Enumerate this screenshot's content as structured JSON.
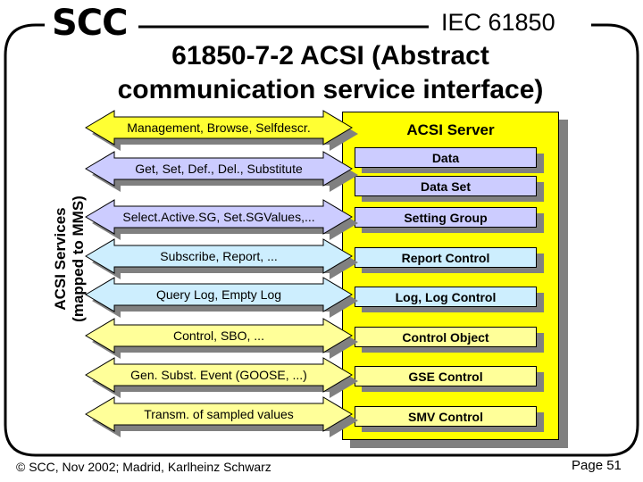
{
  "header": {
    "brand": "SCC",
    "standard": "IEC 61850",
    "title_line1": "61850-7-2 ACSI (Abstract",
    "title_line2": "communication service interface)"
  },
  "side_label": {
    "line1": "ACSI Services",
    "line2": "(mapped to MMS)"
  },
  "colors": {
    "server_fill": "#ffff00",
    "yellow_bright": "#ffff33",
    "lavender": "#ccccff",
    "light_blue": "#cdeefe",
    "light_yellow": "#ffff99",
    "shadow": "#808080"
  },
  "services": [
    {
      "label": "Management, Browse, Selfdescr.",
      "color": "yellow_bright"
    },
    {
      "label": "Get, Set, Def., Del., Substitute",
      "color": "lavender"
    },
    {
      "label": "Select.Active.SG, Set.SGValues,...",
      "color": "lavender"
    },
    {
      "label": "Subscribe, Report, ...",
      "color": "light_blue"
    },
    {
      "label": "Query Log, Empty Log",
      "color": "light_blue"
    },
    {
      "label": "Control, SBO, ...",
      "color": "light_yellow"
    },
    {
      "label": "Gen. Subst. Event (GOOSE, ...)",
      "color": "light_yellow"
    },
    {
      "label": "Transm. of sampled values",
      "color": "light_yellow"
    }
  ],
  "server": {
    "title": "ACSI Server",
    "classes": [
      {
        "label": "Data",
        "color": "lavender"
      },
      {
        "label": "Data Set",
        "color": "lavender"
      },
      {
        "label": "Setting Group",
        "color": "lavender"
      },
      {
        "label": "Report Control",
        "color": "light_blue"
      },
      {
        "label": "Log, Log Control",
        "color": "light_blue"
      },
      {
        "label": "Control Object",
        "color": "light_yellow"
      },
      {
        "label": "GSE Control",
        "color": "light_yellow"
      },
      {
        "label": "SMV Control",
        "color": "light_yellow"
      }
    ]
  },
  "footer": {
    "copyright": "© SCC, Nov 2002; Madrid, Karlheinz Schwarz",
    "page": "Page 51"
  }
}
